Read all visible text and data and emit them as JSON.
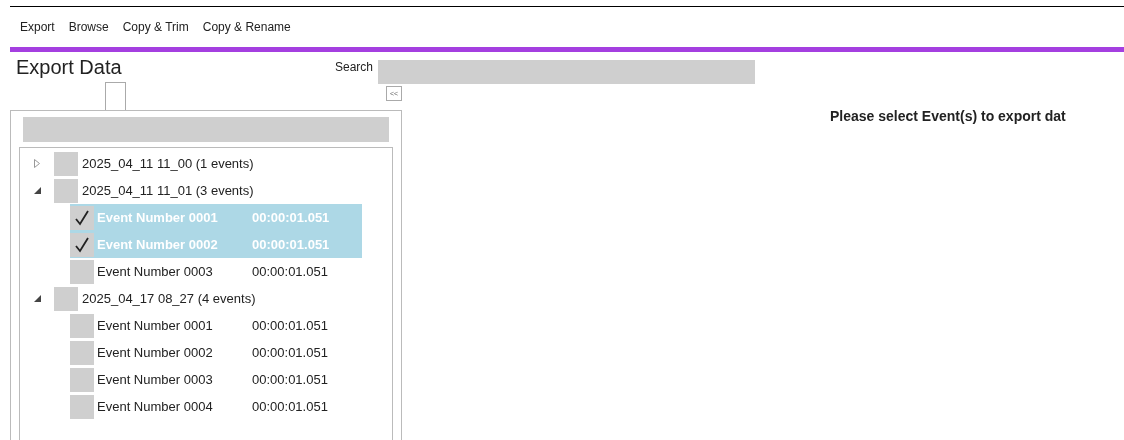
{
  "menu": [
    {
      "label": "Export"
    },
    {
      "label": "Browse"
    },
    {
      "label": "Copy & Trim"
    },
    {
      "label": "Copy & Rename"
    }
  ],
  "title": "Export Data",
  "search": {
    "label": "Search"
  },
  "collapse_button": "<<",
  "tree": [
    {
      "label": "2025_04_11 11_00 (1 events)",
      "expanded": false,
      "checked": false
    },
    {
      "label": "2025_04_11 11_01 (3 events)",
      "expanded": true,
      "checked": false,
      "children": [
        {
          "name": "Event Number 0001",
          "time": "00:00:01.051",
          "checked": true,
          "selected": true
        },
        {
          "name": "Event Number 0002",
          "time": "00:00:01.051",
          "checked": true,
          "selected": true
        },
        {
          "name": "Event Number 0003",
          "time": "00:00:01.051",
          "checked": false,
          "selected": false
        }
      ]
    },
    {
      "label": "2025_04_17 08_27 (4 events)",
      "expanded": true,
      "checked": false,
      "children": [
        {
          "name": "Event Number 0001",
          "time": "00:00:01.051",
          "checked": false,
          "selected": false
        },
        {
          "name": "Event Number 0002",
          "time": "00:00:01.051",
          "checked": false,
          "selected": false
        },
        {
          "name": "Event Number 0003",
          "time": "00:00:01.051",
          "checked": false,
          "selected": false
        },
        {
          "name": "Event Number 0004",
          "time": "00:00:01.051",
          "checked": false,
          "selected": false
        }
      ]
    }
  ],
  "message": "Please select Event(s) to export dat"
}
